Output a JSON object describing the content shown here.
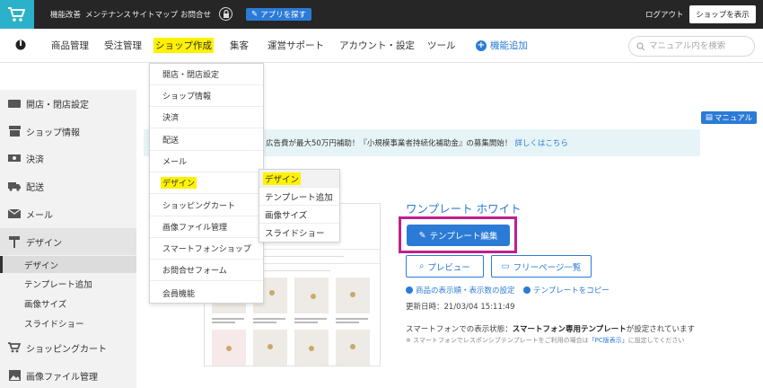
{
  "topbar": {
    "links": [
      "機能改善",
      "メンテナンス",
      "サイトマップ",
      "お問合せ"
    ],
    "app_button": "アプリを探す",
    "logout": "ログアウト",
    "shop_view": "ショップを表示"
  },
  "nav": {
    "items": [
      "商品管理",
      "受注管理",
      "ショップ作成",
      "集客",
      "運営サポート",
      "アカウント・設定",
      "ツール"
    ],
    "add_feature": "機能追加",
    "search_placeholder": "マニュアル内を検索"
  },
  "sidebar": {
    "items": [
      "開店・閉店設定",
      "ショップ情報",
      "決済",
      "配送",
      "メール",
      "デザイン"
    ],
    "sub_items": [
      "デザイン",
      "テンプレート追加",
      "画像サイズ",
      "スライドショー"
    ],
    "items_after": [
      "ショッピングカート",
      "画像ファイル管理"
    ]
  },
  "dropdown": {
    "items": [
      "開店・閉店設定",
      "ショップ情報",
      "決済",
      "配送",
      "メール",
      "デザイン",
      "ショッピングカート",
      "画像ファイル管理",
      "スマートフォンショップ",
      "お問合せフォーム",
      "会員機能"
    ]
  },
  "submenu": {
    "items": [
      "デザイン",
      "テンプレート追加",
      "画像サイズ",
      "スライドショー"
    ]
  },
  "content": {
    "manual_button": "マニュアル",
    "banner_text": "広告費が最大50万円補助！『小規模事業者持続化補助金』の募集開始！",
    "banner_link": "詳しくはこちら",
    "template_title": "ワンプレート ホワイト",
    "edit_button": "テンプレート編集",
    "preview_button": "プレビュー",
    "free_page_button": "フリーページ一覧",
    "link_display": "商品の表示順・表示数の設定",
    "link_copy": "テンプレートをコピー",
    "updated": "更新日時：21/03/04 15:11:49",
    "sp_note_prefix": "スマートフォンでの表示状態：",
    "sp_note_bold": "スマートフォン専用テンプレート",
    "sp_note_suffix": "が設定されています",
    "sp_small_prefix": "※ スマートフォンでレスポンシブテンプレートをご利用の場合は",
    "sp_small_link": "「PC版表示」",
    "sp_small_suffix": "に設定してください"
  }
}
